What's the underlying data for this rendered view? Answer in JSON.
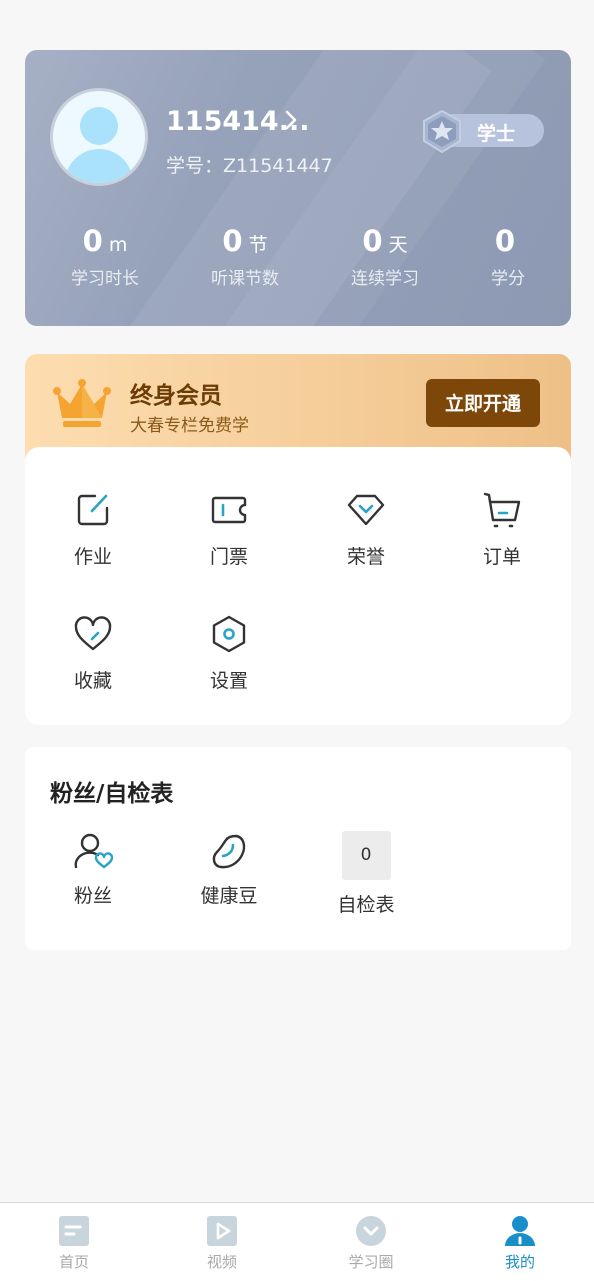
{
  "profile": {
    "name": "115414...",
    "student_id": "学号：Z11541447",
    "rank": "学士",
    "stats": [
      {
        "value": "0",
        "unit": "m",
        "label": "学习时长"
      },
      {
        "value": "0",
        "unit": "节",
        "label": "听课节数"
      },
      {
        "value": "0",
        "unit": "天",
        "label": "连续学习"
      },
      {
        "value": "0",
        "unit": "",
        "label": "学分"
      }
    ]
  },
  "vip": {
    "title": "终身会员",
    "subtitle": "大春专栏免费学",
    "button_label": "立即开通"
  },
  "menu": {
    "items": [
      {
        "label": "作业",
        "icon": "edit-icon"
      },
      {
        "label": "门票",
        "icon": "ticket-icon"
      },
      {
        "label": "荣誉",
        "icon": "honor-icon"
      },
      {
        "label": "订单",
        "icon": "cart-icon"
      },
      {
        "label": "收藏",
        "icon": "heart-icon"
      },
      {
        "label": "设置",
        "icon": "settings-icon"
      }
    ]
  },
  "fans": {
    "title": "粉丝/自检表",
    "items": [
      {
        "label": "粉丝",
        "icon": "fans-icon"
      },
      {
        "label": "健康豆",
        "icon": "bean-icon"
      },
      {
        "label": "自检表",
        "count": "0"
      }
    ]
  },
  "tabbar": {
    "active": "我的",
    "tabs": [
      {
        "label": "首页",
        "icon": "home-icon"
      },
      {
        "label": "视频",
        "icon": "video-icon"
      },
      {
        "label": "学习圈",
        "icon": "circle-icon"
      },
      {
        "label": "我的",
        "icon": "profile-icon"
      }
    ]
  },
  "colors": {
    "profile_card": "#96a2ba",
    "vip_button": "#7c4708",
    "accent": "#1a8ec9",
    "icon_teal": "#2ba3c6"
  }
}
